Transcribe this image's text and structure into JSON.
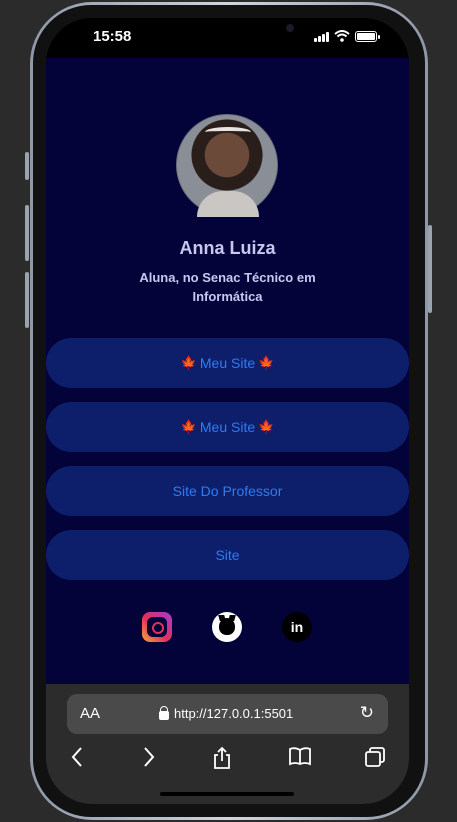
{
  "status": {
    "time": "15:58"
  },
  "profile": {
    "name": "Anna Luiza",
    "bio": "Aluna, no Senac Técnico em Informática"
  },
  "links": [
    {
      "label": "Meu Site",
      "decor": "🍁"
    },
    {
      "label": "Meu Site",
      "decor": "🍁"
    },
    {
      "label": "Site Do Professor"
    },
    {
      "label": "Site"
    }
  ],
  "socials": [
    {
      "icon": "instagram-icon"
    },
    {
      "icon": "github-icon"
    },
    {
      "icon": "linkedin-icon",
      "glyph": "in"
    }
  ],
  "browser": {
    "text_size_label": "AA",
    "url": "http://127.0.0.1:5501"
  },
  "colors": {
    "page_bg": "#030339",
    "button_bg": "#0d1e6a",
    "button_text": "#2f7cf2",
    "heading_text": "#c9c7f0"
  }
}
